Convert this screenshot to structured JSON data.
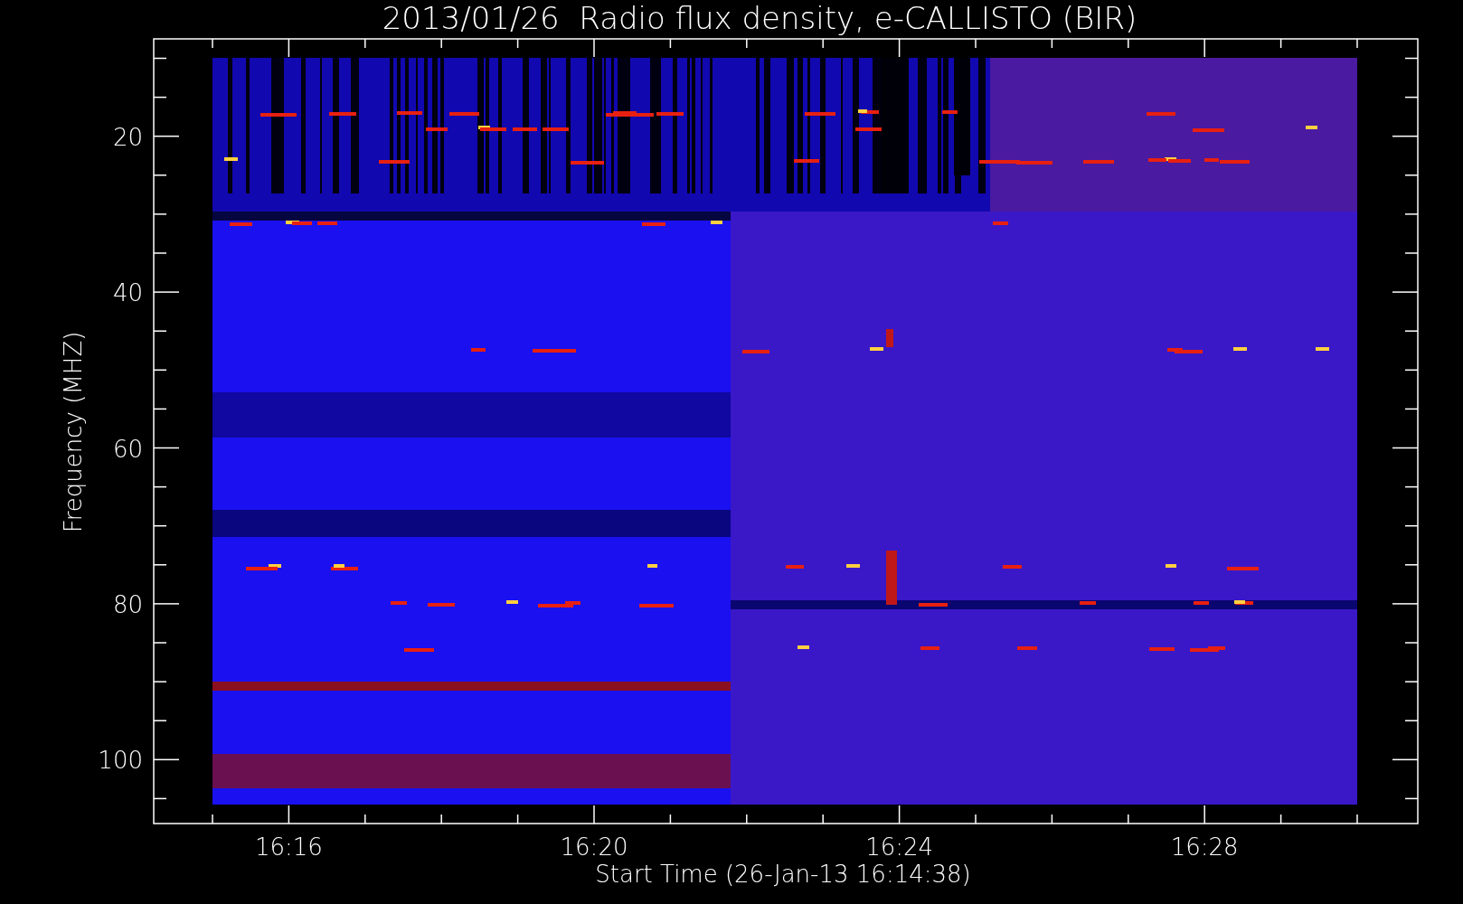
{
  "title": "2013/01/26  Radio flux density, e-CALLISTO (BIR)",
  "x_axis": {
    "label": "Start Time (26-Jan-13 16:14:38)",
    "tick_labels": [
      "16:16",
      "16:20",
      "16:24",
      "16:28"
    ]
  },
  "y_axis": {
    "label": "Frequency (MHZ)",
    "tick_labels": [
      "20",
      "40",
      "60",
      "80",
      "100"
    ]
  }
}
